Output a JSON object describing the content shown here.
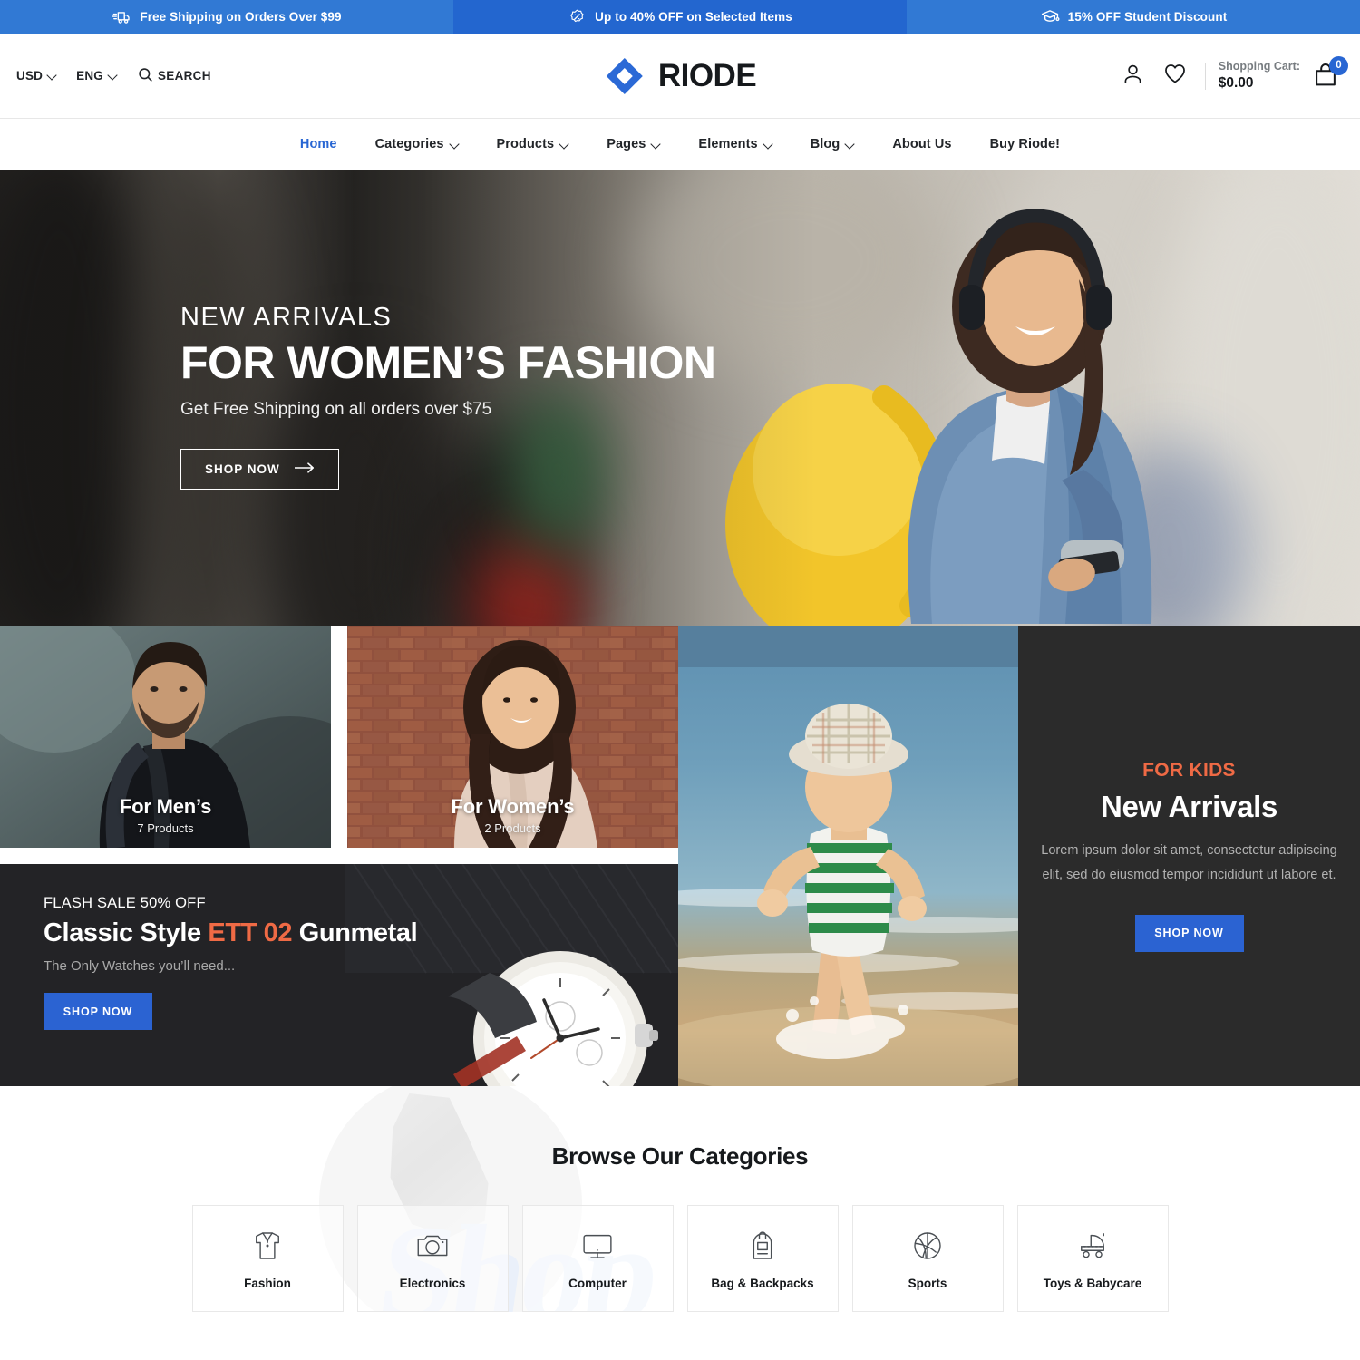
{
  "promo_bar": {
    "segments": [
      {
        "icon": "delivery-truck-icon",
        "text": "Free Shipping on Orders Over $99"
      },
      {
        "icon": "percent-badge-icon",
        "text": "Up to 40% OFF on Selected Items"
      },
      {
        "icon": "graduation-cap-icon",
        "text": "15% OFF Student Discount"
      }
    ],
    "colors": {
      "left": "#3179d4",
      "middle": "#2366cf",
      "right": "#3179d4"
    }
  },
  "header": {
    "currency": "USD",
    "language": "ENG",
    "search_label": "SEARCH",
    "logo_text": "RIODE",
    "logo_color": "#2866d3",
    "account_icon": "user-icon",
    "wishlist_icon": "heart-icon",
    "cart": {
      "label": "Shopping Cart:",
      "total": "$0.00",
      "count": "0",
      "badge_color": "#2866d3"
    }
  },
  "nav": {
    "items": [
      {
        "label": "Home",
        "has_dropdown": false,
        "active": true
      },
      {
        "label": "Categories",
        "has_dropdown": true,
        "active": false
      },
      {
        "label": "Products",
        "has_dropdown": true,
        "active": false
      },
      {
        "label": "Pages",
        "has_dropdown": true,
        "active": false
      },
      {
        "label": "Elements",
        "has_dropdown": true,
        "active": false
      },
      {
        "label": "Blog",
        "has_dropdown": true,
        "active": false
      },
      {
        "label": "About Us",
        "has_dropdown": false,
        "active": false
      },
      {
        "label": "Buy Riode!",
        "has_dropdown": false,
        "active": false
      }
    ],
    "active_color": "#2866d3"
  },
  "hero": {
    "eyebrow": "NEW ARRIVALS",
    "title": "FOR WOMEN’S FASHION",
    "subtitle": "Get Free Shipping on all orders over $75",
    "cta": "SHOP NOW",
    "cta_icon": "arrow-right-icon"
  },
  "banners": {
    "men": {
      "title": "For Men’s",
      "count": "7 Products"
    },
    "women": {
      "title": "For Women’s",
      "count": "2 Products"
    },
    "flash": {
      "eyebrow": "FLASH SALE 50% OFF",
      "title_part1": "Classic Style ",
      "title_accent": "ETT 02",
      "title_part2": " Gunmetal",
      "accent_color": "#ef6a45",
      "subtitle": "The Only Watches you’ll need...",
      "cta": "SHOP NOW"
    },
    "kids": {
      "eyebrow": "FOR KIDS",
      "eyebrow_color": "#ef6a45",
      "title": "New Arrivals",
      "description": "Lorem ipsum dolor sit amet, consectetur adipiscing elit, sed do eiusmod tempor incididunt ut labore et.",
      "cta": "SHOP NOW",
      "cta_color": "#2b63d2"
    }
  },
  "browse": {
    "title": "Browse Our Categories",
    "categories": [
      {
        "label": "Fashion",
        "icon": "shirt-icon"
      },
      {
        "label": "Electronics",
        "icon": "camera-icon"
      },
      {
        "label": "Computer",
        "icon": "monitor-icon"
      },
      {
        "label": "Bag & Backpacks",
        "icon": "backpack-icon"
      },
      {
        "label": "Sports",
        "icon": "basketball-icon"
      },
      {
        "label": "Toys & Babycare",
        "icon": "stroller-icon"
      }
    ]
  }
}
